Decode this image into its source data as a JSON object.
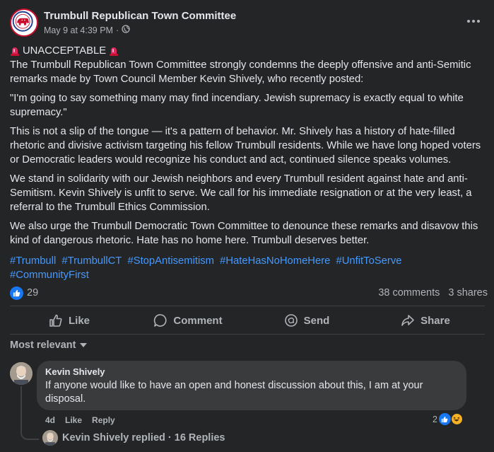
{
  "post": {
    "author": "Trumbull Republican Town Committee",
    "date": "May 9 at 4:39 PM",
    "separator": "·",
    "privacy_icon": "globe-icon",
    "headline": "UNACCEPTABLE",
    "paragraphs": [
      "The Trumbull Republican Town Committee strongly condemns the deeply offensive and anti-Semitic remarks made by Town Council Member Kevin Shively, who recently posted:",
      "\"I'm going to say something many may find incendiary. Jewish supremacy is exactly equal to white supremacy.\"",
      "This is not a slip of the tongue — it's a pattern of behavior. Mr. Shively has a history of hate-filled rhetoric and divisive activism targeting his fellow Trumbull residents. While we have long hoped voters or Democratic leaders would recognize his conduct and act, continued silence speaks volumes.",
      "We stand in solidarity with our Jewish neighbors and every Trumbull resident against hate and anti-Semitism. Kevin Shively is unfit to serve. We call for his immediate resignation or at the very least, a referral to the Trumbull Ethics Commission.",
      "We also urge the Trumbull Democratic Town Committee to denounce these remarks and disavow this kind of dangerous rhetoric. Hate has no home here. Trumbull deserves better."
    ],
    "hashtags": [
      "#Trumbull",
      "#TrumbullCT",
      "#StopAntisemitism",
      "#HateHasNoHomeHere",
      "#UnfitToServe",
      "#CommunityFirst"
    ]
  },
  "stats": {
    "reactions": "29",
    "comments": "38 comments",
    "shares": "3 shares"
  },
  "actions": {
    "like": "Like",
    "comment": "Comment",
    "send": "Send",
    "share": "Share"
  },
  "sort_label": "Most relevant",
  "comment": {
    "author": "Kevin Shively",
    "text": "If anyone would like to have an open and honest discussion about this, I am at your disposal.",
    "time": "4d",
    "like": "Like",
    "reply": "Reply",
    "reaction_count": "2",
    "replies_label": "Kevin Shively replied · 16 Replies"
  },
  "colors": {
    "background": "#242526",
    "text": "#e4e6eb",
    "muted": "#b0b3b8",
    "link": "#4599ff",
    "bubble": "#3a3b3c",
    "accent": "#1877f2"
  }
}
